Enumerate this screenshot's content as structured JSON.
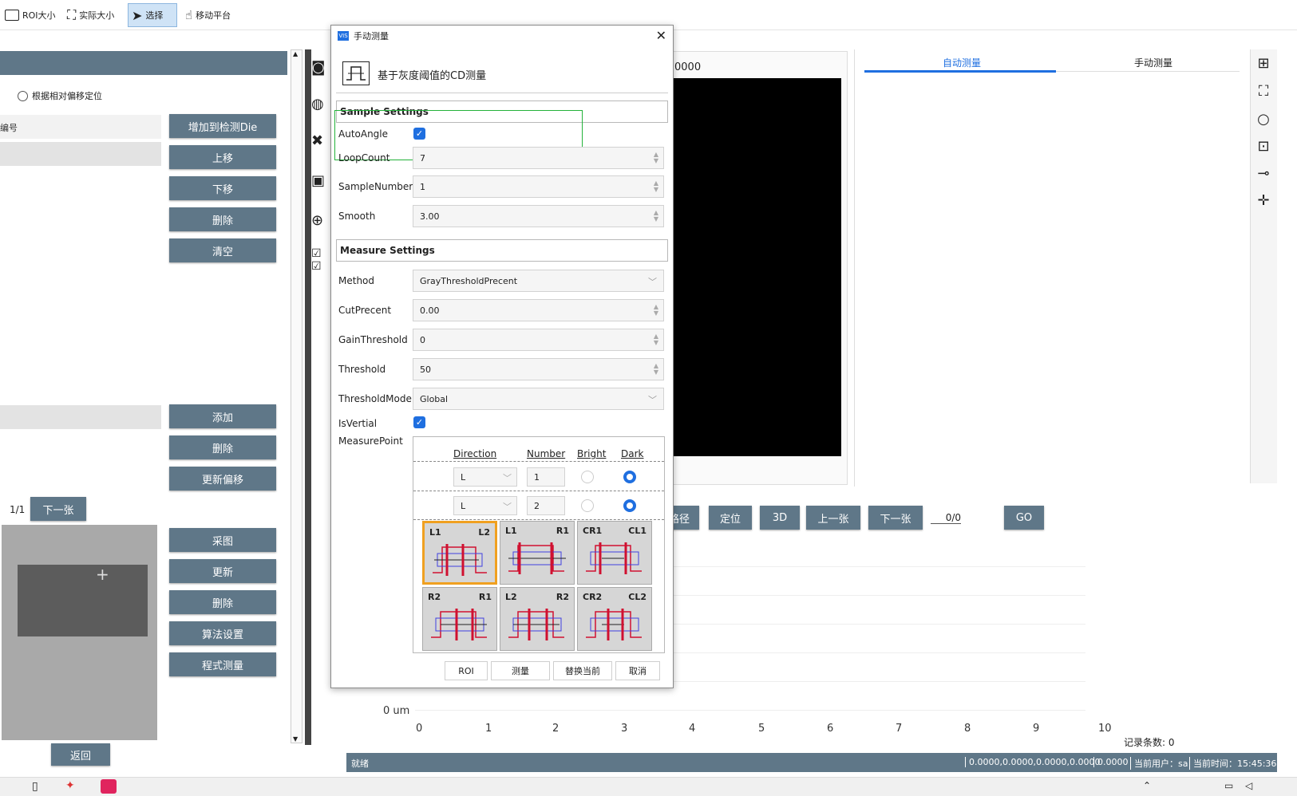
{
  "toolbar": {
    "items": [
      {
        "label": "ROI大小"
      },
      {
        "label": "实际大小"
      },
      {
        "label": "选择"
      },
      {
        "label": "移动平台"
      }
    ]
  },
  "left": {
    "radio_label": "根据相对偏移定位",
    "col_label": "编号",
    "buttons1": [
      "增加到检测Die",
      "上移",
      "下移",
      "删除",
      "清空"
    ],
    "buttons2": [
      "添加",
      "删除",
      "更新偏移"
    ],
    "pager": "1/1",
    "next_label": "下一张",
    "buttons3": [
      "采图",
      "更新",
      "删除",
      "算法设置",
      "程式测量"
    ],
    "back_label": "返回"
  },
  "dialog": {
    "title": "手动测量",
    "subtitle": "基于灰度阈值的CD测量",
    "sample_header": "Sample Settings",
    "measure_header": "Measure Settings",
    "auto_angle_label": "AutoAngle",
    "auto_angle_checked": true,
    "loop_count_label": "LoopCount",
    "loop_count": "7",
    "sample_number_label": "SampleNumber",
    "sample_number": "1",
    "smooth_label": "Smooth",
    "smooth": "3.00",
    "method_label": "Method",
    "method": "GrayThresholdPrecent",
    "cut_precent_label": "CutPrecent",
    "cut_precent": "0.00",
    "gain_threshold_label": "GainThreshold",
    "gain_threshold": "0",
    "threshold_label": "Threshold",
    "threshold": "50",
    "threshold_mode_label": "ThresholdMode",
    "threshold_mode": "Global",
    "is_vertial_label": "IsVertial",
    "is_vertial_checked": true,
    "measure_point_label": "MeasurePoint",
    "mp_headers": {
      "direction": "Direction",
      "number": "Number",
      "bright": "Bright",
      "dark": "Dark"
    },
    "mp_rows": [
      {
        "direction": "L",
        "number": "1",
        "selected": "dark"
      },
      {
        "direction": "L",
        "number": "2",
        "selected": "dark"
      }
    ],
    "tiles": [
      {
        "left": "L1",
        "right": "L2"
      },
      {
        "left": "L1",
        "right": "R1"
      },
      {
        "left": "CR1",
        "right": "CL1"
      },
      {
        "left": "R2",
        "right": "R1"
      },
      {
        "left": "L2",
        "right": "R2"
      },
      {
        "left": "CR2",
        "right": "CL2"
      }
    ],
    "selected_tile": 0,
    "footer_buttons": [
      "ROI",
      "测量",
      "替换当前",
      "取消"
    ],
    "check_mark": "✓"
  },
  "viewer": {
    "coord_text": "0000"
  },
  "right": {
    "tabs": [
      "自动测量",
      "手动测量"
    ],
    "active_tab": 0
  },
  "nav": {
    "buttons": [
      "路径",
      "定位",
      "3D",
      "上一张",
      "下一张",
      "GO"
    ],
    "counter": "0/0"
  },
  "chart": {
    "y_label": "0 um",
    "x_ticks": [
      "0",
      "1",
      "2",
      "3",
      "4",
      "5",
      "6",
      "7",
      "8",
      "9",
      "10"
    ],
    "record_count": "记录条数: 0"
  },
  "status": {
    "ready": "就绪",
    "coords": "0.0000,0.0000,0.0000,0.0000",
    "value": "0.0000",
    "user": "当前用户：sa",
    "time": "当前时间：15:45:36"
  },
  "colors": {
    "accent": "#5f7788",
    "tab_active": "#1f6fe0",
    "highlight_green": "#23b23a",
    "tile_selected": "#f0a020"
  }
}
